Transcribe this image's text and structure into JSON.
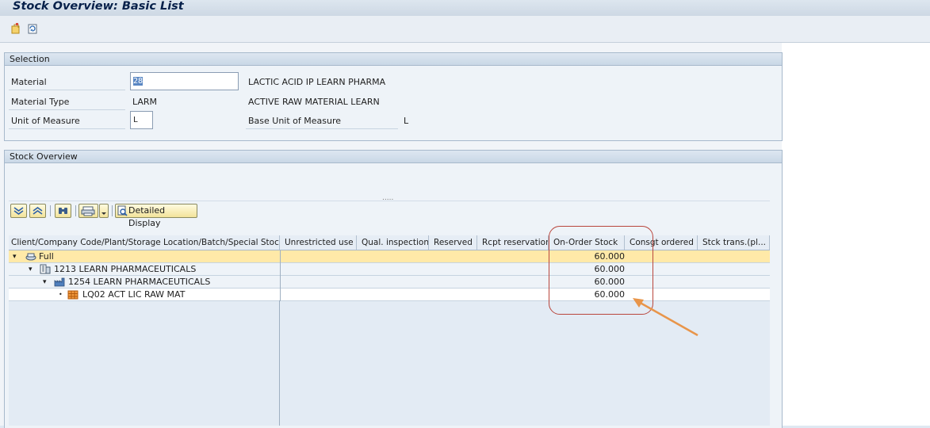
{
  "window": {
    "title": "Stock Overview: Basic List"
  },
  "app_toolbar": {
    "icons": [
      "new-document-icon",
      "refresh-icon"
    ]
  },
  "selection": {
    "header": "Selection",
    "material_label": "Material",
    "material_value": "28",
    "material_desc": "LACTIC ACID IP LEARN PHARMA",
    "material_type_label": "Material Type",
    "material_type_value": "LARM",
    "material_type_desc": "ACTIVE RAW MATERIAL LEARN",
    "uom_label": "Unit of Measure",
    "uom_value": "L",
    "base_uom_label": "Base Unit of Measure",
    "base_uom_value": "L"
  },
  "stock_overview": {
    "header": "Stock Overview",
    "splitter": ".....",
    "detailed_display_label": "Detailed Display",
    "toolbar_icons": [
      "expand-all-icon",
      "collapse-all-icon",
      "find-icon",
      "print-icon",
      "print-dropdown-icon",
      "detailed-display-icon"
    ],
    "columns": [
      "Client/Company Code/Plant/Storage Location/Batch/Special Stock",
      "Unrestricted use",
      "Qual. inspection",
      "Reserved",
      "Rcpt reservation",
      "On-Order Stock",
      "Consgt ordered",
      "Stck trans.(pl..."
    ],
    "rows": [
      {
        "indent": 0,
        "expander": "▾",
        "icon": "client-icon",
        "label": "Full",
        "on_order": "60.000",
        "highlight": true
      },
      {
        "indent": 1,
        "expander": "▾",
        "icon": "company-code-icon",
        "label": "1213 LEARN PHARMACEUTICALS",
        "on_order": "60.000",
        "highlight": false
      },
      {
        "indent": 2,
        "expander": "▾",
        "icon": "plant-icon",
        "label": "1254 LEARN PHARMACEUTICALS",
        "on_order": "60.000",
        "highlight": false
      },
      {
        "indent": 3,
        "expander": "•",
        "icon": "storage-location-icon",
        "label": "LQ02 ACT LIC RAW MAT",
        "on_order": "60.000",
        "highlight": false
      }
    ]
  },
  "colors": {
    "title": "#06204a",
    "highlight_row": "#ffe9a8",
    "annotation_circle": "#b9463c",
    "annotation_arrow": "#e8954a"
  }
}
